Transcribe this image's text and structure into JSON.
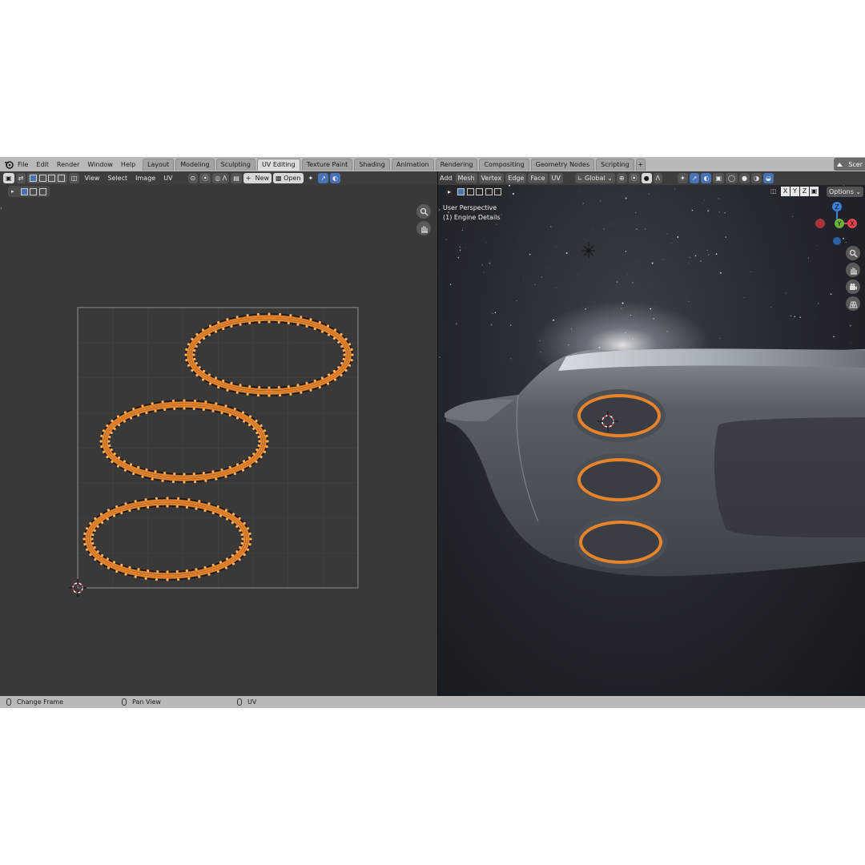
{
  "menu": [
    "File",
    "Edit",
    "Render",
    "Window",
    "Help"
  ],
  "workspace_tabs": [
    {
      "label": "Layout",
      "active": false
    },
    {
      "label": "Modeling",
      "active": false
    },
    {
      "label": "Sculpting",
      "active": false
    },
    {
      "label": "UV Editing",
      "active": true
    },
    {
      "label": "Texture Paint",
      "active": false
    },
    {
      "label": "Shading",
      "active": false
    },
    {
      "label": "Animation",
      "active": false
    },
    {
      "label": "Rendering",
      "active": false
    },
    {
      "label": "Compositing",
      "active": false
    },
    {
      "label": "Geometry Nodes",
      "active": false
    },
    {
      "label": "Scripting",
      "active": false
    }
  ],
  "add_tab_symbol": "+",
  "scene_label": "Scer",
  "uv_editor": {
    "menus": [
      "View",
      "Select",
      "Image",
      "UV"
    ],
    "new_label": "New",
    "open_label": "Open",
    "add_symbol": "+"
  },
  "viewport": {
    "menus": [
      "Add",
      "Mesh",
      "Vertex",
      "Edge",
      "Face",
      "UV"
    ],
    "transform_orientation": "Global",
    "options_label": "Options",
    "axis_lock": [
      "X",
      "Y",
      "Z"
    ],
    "perspective_label": "User Perspective",
    "object_label": "(1) Engine Details",
    "gizmo": {
      "z": "Z",
      "y": "Y",
      "x": "X"
    }
  },
  "status_bar": {
    "left": "Change Frame",
    "middle": "Pan View",
    "right": "UV"
  },
  "colors": {
    "accent_blue": "#4772b3",
    "uv_orange": "#e8832a",
    "axis_x": "#e0454f",
    "axis_y": "#6fb03a",
    "axis_z": "#3e7fd8"
  }
}
